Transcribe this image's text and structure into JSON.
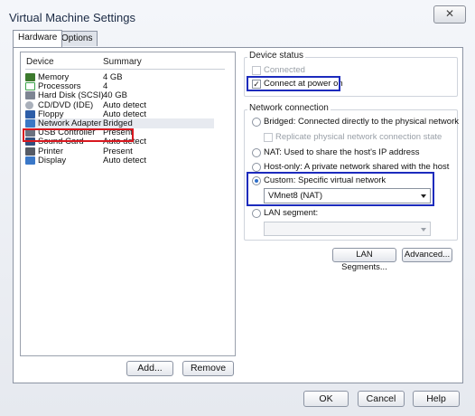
{
  "window": {
    "title": "Virtual Machine Settings",
    "close_glyph": "✕"
  },
  "tabs": [
    {
      "label": "Hardware"
    },
    {
      "label": "Options"
    }
  ],
  "device_list": {
    "col_device": "Device",
    "col_summary": "Summary",
    "rows": [
      {
        "name": "Memory",
        "summary": "4 GB",
        "icon": "memory-icon",
        "color": "#3d7a2d"
      },
      {
        "name": "Processors",
        "summary": "4",
        "icon": "processor-icon",
        "color": "#3aa34a"
      },
      {
        "name": "Hard Disk (SCSI)",
        "summary": "40 GB",
        "icon": "hard-disk-icon",
        "color": "#7d8593"
      },
      {
        "name": "CD/DVD (IDE)",
        "summary": "Auto detect",
        "icon": "cd-dvd-icon",
        "color": "#a9b0bb"
      },
      {
        "name": "Floppy",
        "summary": "Auto detect",
        "icon": "floppy-icon",
        "color": "#2d5ea8"
      },
      {
        "name": "Network Adapter",
        "summary": "Bridged",
        "icon": "network-adapter-icon",
        "color": "#3b78c6"
      },
      {
        "name": "USB Controller",
        "summary": "Present",
        "icon": "usb-controller-icon",
        "color": "#6b7280"
      },
      {
        "name": "Sound Card",
        "summary": "Auto detect",
        "icon": "sound-card-icon",
        "color": "#33517f"
      },
      {
        "name": "Printer",
        "summary": "Present",
        "icon": "printer-icon",
        "color": "#555b66"
      },
      {
        "name": "Display",
        "summary": "Auto detect",
        "icon": "display-icon",
        "color": "#3a78c8"
      }
    ],
    "add_label": "Add...",
    "remove_label": "Remove"
  },
  "device_status": {
    "title": "Device status",
    "connected_label": "Connected",
    "connect_at_power_on_label": "Connect at power on",
    "checkmark": "✓"
  },
  "network_connection": {
    "title": "Network connection",
    "bridged_label": "Bridged: Connected directly to the physical network",
    "replicate_label": "Replicate physical network connection state",
    "nat_label": "NAT: Used to share the host's IP address",
    "hostonly_label": "Host-only: A private network shared with the host",
    "custom_label": "Custom: Specific virtual network",
    "custom_value": "VMnet8 (NAT)",
    "lan_label": "LAN segment:",
    "lan_value": ""
  },
  "buttons": {
    "lan_segments": "LAN Segments...",
    "advanced": "Advanced...",
    "ok": "OK",
    "cancel": "Cancel",
    "help": "Help"
  },
  "colors": {
    "highlight_red": "#d9181f",
    "highlight_blue": "#1c2bbd"
  }
}
